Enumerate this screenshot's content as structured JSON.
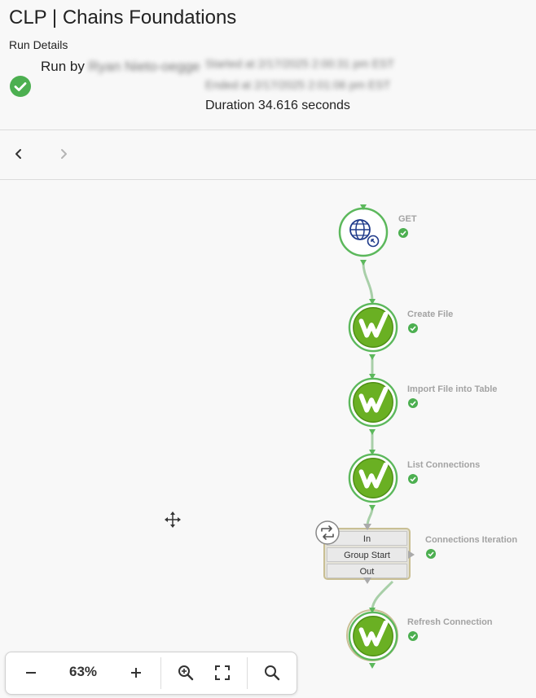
{
  "header": {
    "title": "CLP | Chains Foundations",
    "subtitle": "Run Details",
    "run_by_label": "Run by",
    "run_by_name": "Ryan Nieto-oegge",
    "started": "Started at 2/17/2025 2:00:31 pm EST",
    "ended": "Ended at 2/17/2025 2:01:06 pm EST",
    "duration": "Duration 34.616 seconds"
  },
  "nav": {
    "prev_icon": "chevron-left-icon",
    "next_icon": "chevron-right-icon"
  },
  "nodes": [
    {
      "label": "GET",
      "status": "success",
      "icon": "globe-icon"
    },
    {
      "label": "Create File",
      "status": "success",
      "icon": "workiva-check-icon"
    },
    {
      "label": "Import File into Table",
      "status": "success",
      "icon": "workiva-check-icon"
    },
    {
      "label": "List Connections",
      "status": "success",
      "icon": "workiva-check-icon"
    },
    {
      "label": "Connections Iteration",
      "status": "success",
      "icon": "loop-icon",
      "rows": [
        "In",
        "Group Start",
        "Out"
      ]
    },
    {
      "label": "Refresh Connection",
      "status": "success",
      "icon": "workiva-check-icon"
    }
  ],
  "toolbar": {
    "zoom_out_icon": "minus-icon",
    "zoom": "63%",
    "zoom_in_icon": "plus-icon",
    "magnify_icon": "zoom-in-icon",
    "fit_icon": "fit-screen-icon",
    "search_icon": "search-icon"
  },
  "colors": {
    "success": "#4caf50",
    "node_ring": "#5cb85c",
    "node_fill": "#6ab023",
    "connector": "#a8cfa8",
    "group_border": "#c9bf94"
  }
}
